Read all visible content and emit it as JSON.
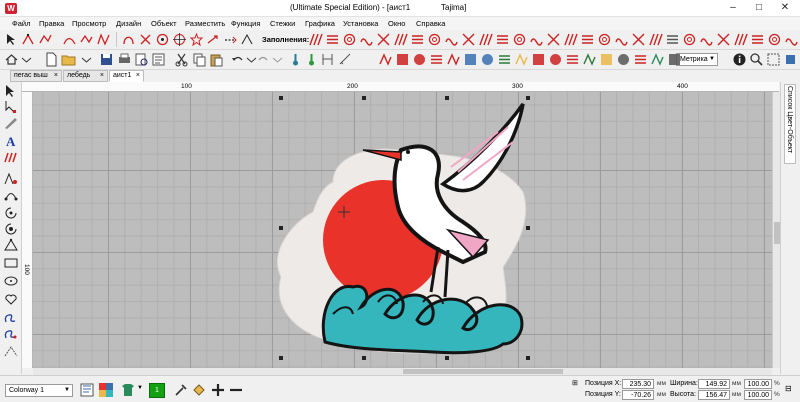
{
  "window": {
    "title": "(Ultimate Special Edition) - [аист1",
    "machine": "Tajima]",
    "logo": "W"
  },
  "menu": [
    "Файл",
    "Правка",
    "Просмотр",
    "Дизайн",
    "Объект",
    "Разместить",
    "Функция",
    "Стежки",
    "Графика",
    "Установка",
    "Окно",
    "Справка"
  ],
  "toolbar": {
    "fill_label": "Заполнения:",
    "units_value": "Метрика"
  },
  "tabs": [
    {
      "label": "пегас выш",
      "close": "×"
    },
    {
      "label": "лебедь",
      "close": "×"
    },
    {
      "label": "аист1",
      "close": "×"
    }
  ],
  "ruler": {
    "h_ticks": [
      "100",
      "200",
      "300",
      "400"
    ],
    "v_ticks": [
      "100"
    ]
  },
  "side_panel": {
    "label": "Список Цвет-Объект"
  },
  "status": {
    "colorway": "Colorway 1",
    "current_color": "1",
    "pos_x_label": "Позиция X:",
    "pos_x": "235.30",
    "pos_y_label": "Позиция Y:",
    "pos_y": "-70.26",
    "width_label": "Ширина:",
    "width": "149.92",
    "height_label": "Высота:",
    "height": "156.47",
    "unit_mm": "мм",
    "scale_w": "100.00",
    "scale_h": "100.00",
    "unit_pct": "%"
  },
  "colors": {
    "accent_red": "#e8322a",
    "teal": "#35b6bd",
    "pink": "#f2a6c6",
    "cloud": "#efe9e6",
    "canvas_grid": "#bdbdbd"
  }
}
